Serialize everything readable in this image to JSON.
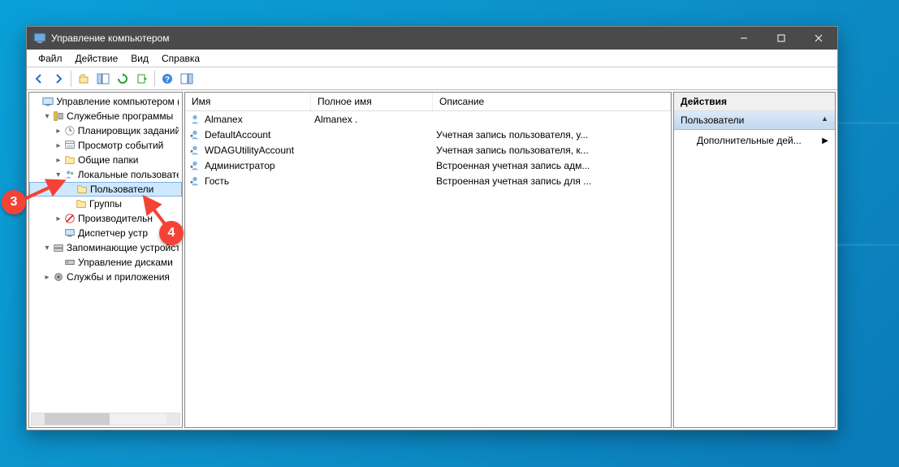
{
  "window": {
    "title": "Управление компьютером"
  },
  "menu": {
    "file": "Файл",
    "action": "Действие",
    "view": "Вид",
    "help": "Справка"
  },
  "tree": {
    "root": "Управление компьютером (л",
    "system_tools": "Служебные программы",
    "task_scheduler": "Планировщик заданий",
    "event_viewer": "Просмотр событий",
    "shared_folders": "Общие папки",
    "local_users": "Локальные пользовате",
    "users": "Пользователи",
    "groups": "Группы",
    "performance": "Производительн",
    "device_manager": "Диспетчер устр",
    "storage": "Запоминающие устройст",
    "disk_mgmt": "Управление дисками",
    "services_apps": "Службы и приложения"
  },
  "list": {
    "cols": {
      "name": "Имя",
      "fullname": "Полное имя",
      "desc": "Описание"
    },
    "rows": [
      {
        "name": "Almanex",
        "fullname": "Almanex .",
        "desc": ""
      },
      {
        "name": "DefaultAccount",
        "fullname": "",
        "desc": "Учетная запись пользователя, у..."
      },
      {
        "name": "WDAGUtilityAccount",
        "fullname": "",
        "desc": "Учетная запись пользователя, к..."
      },
      {
        "name": "Администратор",
        "fullname": "",
        "desc": "Встроенная учетная запись адм..."
      },
      {
        "name": "Гость",
        "fullname": "",
        "desc": "Встроенная учетная запись для ..."
      }
    ]
  },
  "actions": {
    "header": "Действия",
    "section": "Пользователи",
    "more": "Дополнительные дей..."
  },
  "callouts": {
    "c3": "3",
    "c4": "4"
  }
}
